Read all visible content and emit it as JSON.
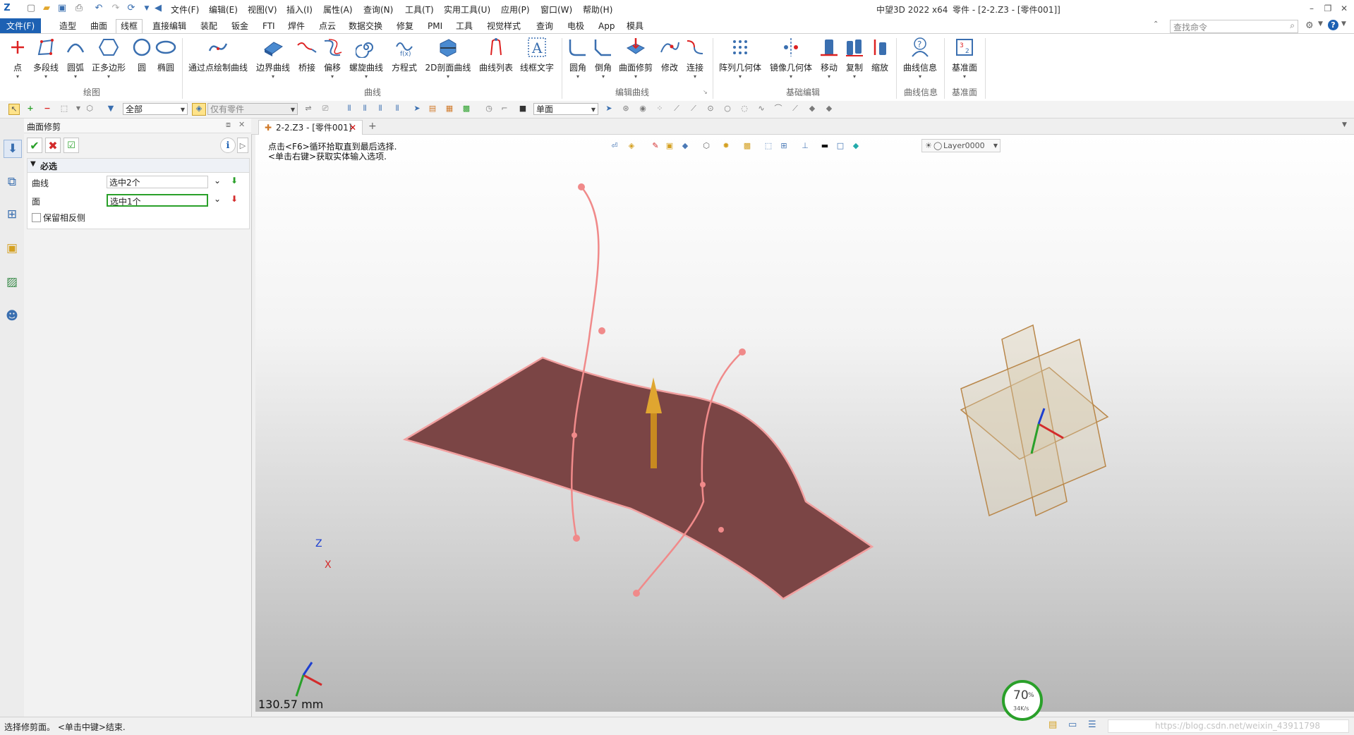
{
  "app": {
    "window_title": "中望3D 2022 x64",
    "doc_title": "零件 - [2-2.Z3 - [零件001]]",
    "search_placeholder": "查找命令"
  },
  "menubar": [
    "文件(F)",
    "编辑(E)",
    "视图(V)",
    "插入(I)",
    "属性(A)",
    "查询(N)",
    "工具(T)",
    "实用工具(U)",
    "应用(P)",
    "窗口(W)",
    "帮助(H)"
  ],
  "ribbon_tabs": [
    "文件(F)",
    "造型",
    "曲面",
    "线框",
    "直接编辑",
    "装配",
    "钣金",
    "FTI",
    "焊件",
    "点云",
    "数据交换",
    "修复",
    "PMI",
    "工具",
    "视觉样式",
    "查询",
    "电极",
    "App",
    "模具"
  ],
  "ribbon": {
    "draw": [
      "点",
      "多段线",
      "圆弧",
      "正多边形",
      "圆",
      "椭圆"
    ],
    "curve": [
      "通过点绘制曲线",
      "边界曲线",
      "桥接",
      "偏移",
      "螺旋曲线",
      "方程式",
      "2D剖面曲线",
      "曲线列表",
      "线框文字"
    ],
    "edit": [
      "圆角",
      "倒角",
      "曲面修剪",
      "修改",
      "连接"
    ],
    "basic": [
      "阵列几何体",
      "镜像几何体",
      "移动",
      "复制",
      "缩放"
    ],
    "info": [
      "曲线信息"
    ],
    "datum": [
      "基准面"
    ],
    "groups": [
      "绘图",
      "曲线",
      "编辑曲线",
      "基础编辑",
      "曲线信息",
      "基准面"
    ]
  },
  "toolbar2": {
    "filter_value": "全部",
    "scope_value": "仅有零件",
    "face_mode": "单面"
  },
  "panel": {
    "title": "曲面修剪",
    "section": "必选",
    "curve_label": "曲线",
    "curve_value": "选中2个",
    "face_label": "面",
    "face_value": "选中1个",
    "keep_opposite": "保留相反侧"
  },
  "document": {
    "tab_label": "2-2.Z3 - [零件001]",
    "hint1": "点击<F6>循环拾取直到最后选择.",
    "hint2": "<单击右键>获取实体输入选项.",
    "layer": "Layer0000",
    "scale": "130.57 mm",
    "axis_z": "Z",
    "axis_x": "X"
  },
  "status": {
    "prompt": "选择修剪面。 <单击中键>结束.",
    "perf_percent": "70",
    "perf_unit": "%",
    "perf_speed": "34K/s",
    "watermark": "https://blog.csdn.net/weixin_43911798"
  },
  "colors": {
    "accent": "#1d61b3",
    "surface": "#7b4545",
    "surface_edge": "#f2a0a0",
    "arrow": "#d79a2a",
    "ok_green": "#2aa02a",
    "cancel_red": "#d32b2b"
  }
}
